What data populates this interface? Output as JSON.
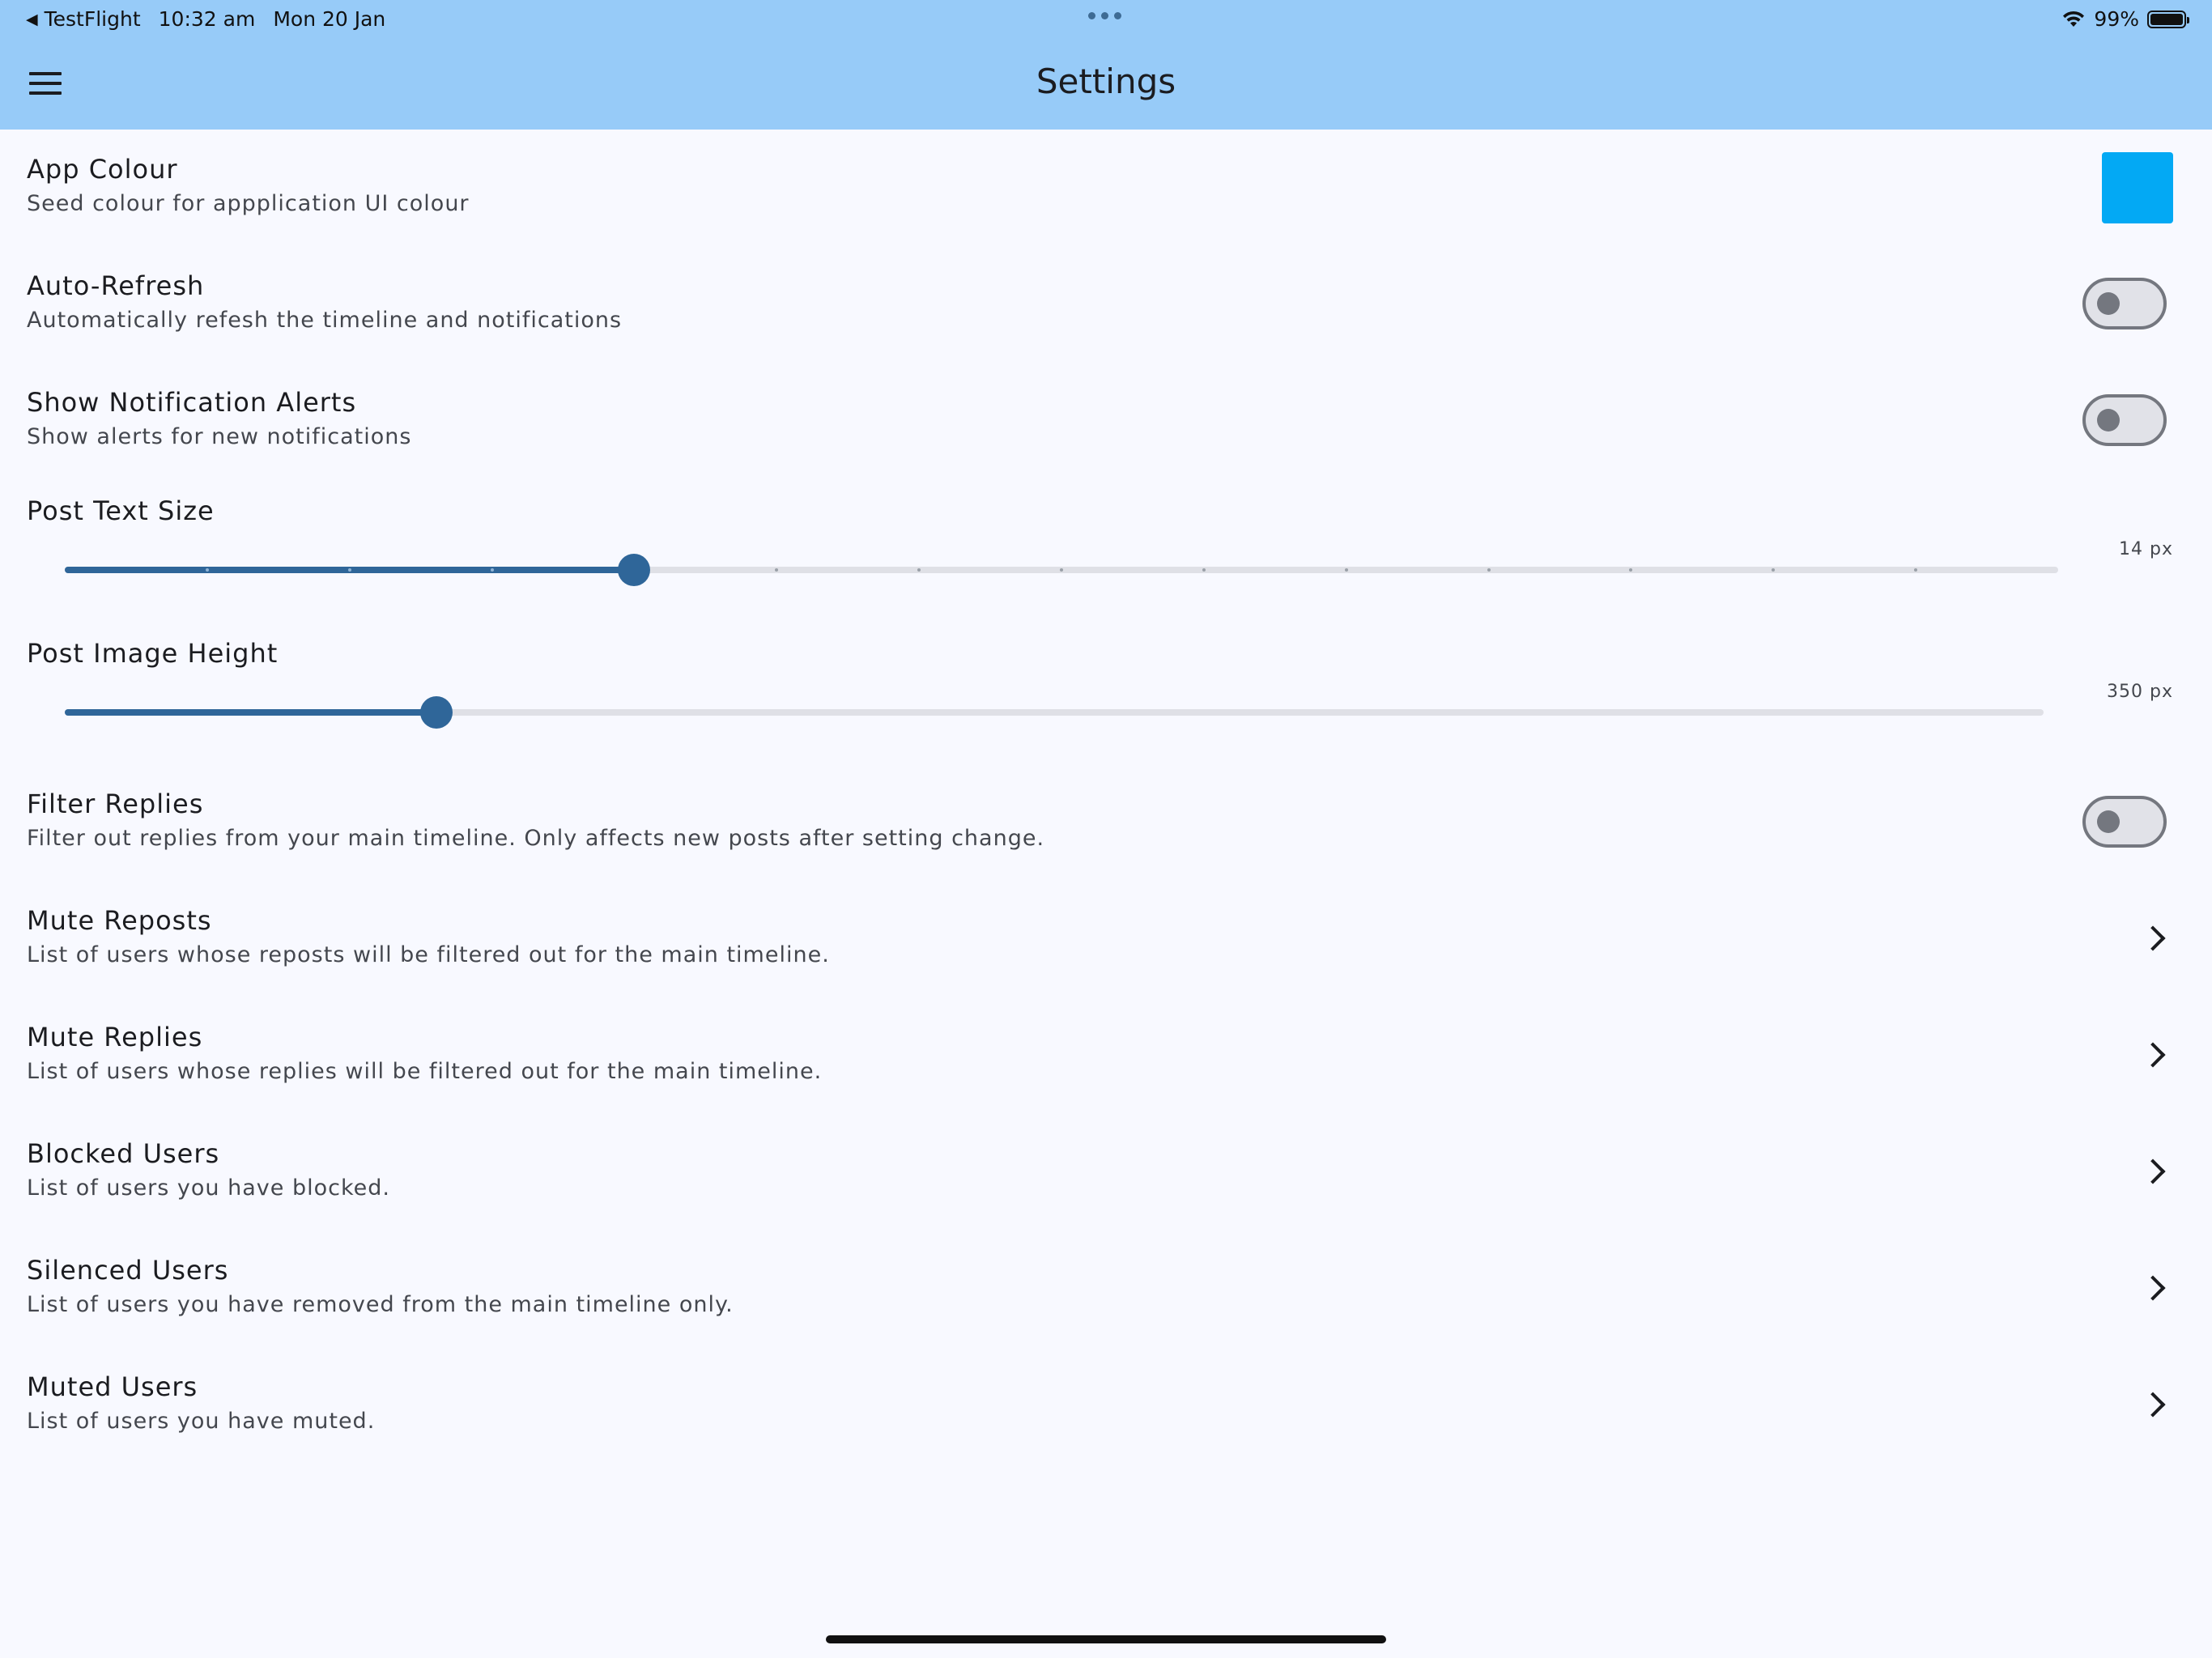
{
  "status_bar": {
    "back_app": "TestFlight",
    "time": "10:32 am",
    "date": "Mon 20 Jan",
    "battery": "99%",
    "battery_level": 0.99
  },
  "header": {
    "title": "Settings",
    "menu_icon": "hamburger-menu-icon"
  },
  "settings": {
    "app_colour": {
      "title": "App Colour",
      "subtitle": "Seed colour for appplication UI colour",
      "color": "#03a9f4"
    },
    "auto_refresh": {
      "title": "Auto-Refresh",
      "subtitle": "Automatically refesh the timeline and notifications",
      "enabled": false
    },
    "notification_alerts": {
      "title": "Show Notification Alerts",
      "subtitle": "Show alerts for new notifications",
      "enabled": false
    },
    "post_text_size": {
      "title": "Post Text Size",
      "value_label": "14 px",
      "fraction": 0.2857,
      "divisions": 14
    },
    "post_image_height": {
      "title": "Post Image Height",
      "value_label": "350 px",
      "fraction": 0.188
    },
    "filter_replies": {
      "title": "Filter Replies",
      "subtitle": "Filter out replies from your main timeline. Only affects new posts after setting change.",
      "enabled": false
    },
    "mute_reposts": {
      "title": "Mute Reposts",
      "subtitle": "List of users whose reposts will be filtered out for the main timeline."
    },
    "mute_replies": {
      "title": "Mute Replies",
      "subtitle": "List of users whose replies will be filtered out for the main timeline."
    },
    "blocked_users": {
      "title": "Blocked Users",
      "subtitle": "List of users you have blocked."
    },
    "silenced_users": {
      "title": "Silenced Users",
      "subtitle": "List of users you have removed from the main timeline only."
    },
    "muted_users": {
      "title": "Muted Users",
      "subtitle": "List of users you have muted."
    }
  },
  "colors": {
    "appbar": "#97cbf8",
    "background": "#f8f9ff",
    "slider_active": "#2f6699"
  }
}
